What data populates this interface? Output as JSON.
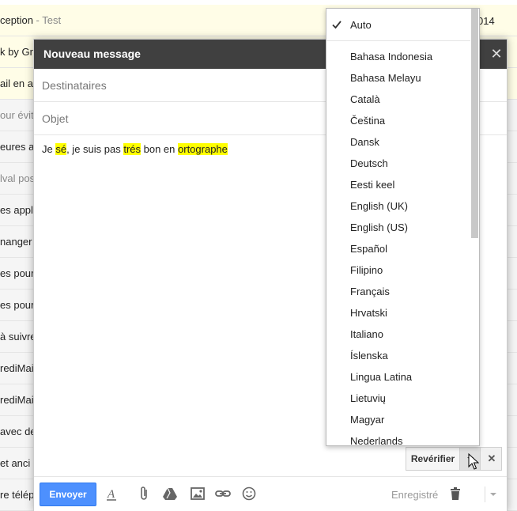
{
  "background": {
    "rows": [
      {
        "text": "ception",
        "muted": " - Test",
        "style": "unread"
      },
      {
        "text": "k by Gm",
        "muted": "",
        "style": "unread"
      },
      {
        "text": "ail en a",
        "muted": "",
        "style": "unread"
      },
      {
        "text": "",
        "muted": "our évite",
        "style": "read"
      },
      {
        "text": "eures a",
        "muted": "",
        "style": "read"
      },
      {
        "text": "",
        "muted": "lval pos",
        "style": "read"
      },
      {
        "text": "es applis",
        "muted": "",
        "style": "read"
      },
      {
        "text": "nanger t",
        "muted": "",
        "style": "read"
      },
      {
        "text": "es pour",
        "muted": "",
        "style": "read"
      },
      {
        "text": "es pour",
        "muted": "",
        "style": "read"
      },
      {
        "text": "à suivre",
        "muted": "",
        "style": "read"
      },
      {
        "text": "rediMai",
        "muted": "",
        "style": "read"
      },
      {
        "text": "rediMai",
        "muted": "",
        "style": "read"
      },
      {
        "text": "avec de",
        "muted": "",
        "style": "read"
      },
      {
        "text": " et anci",
        "muted": "",
        "style": "read"
      },
      {
        "text": "re télépl",
        "muted": "",
        "style": "read"
      }
    ],
    "date_fragment": "014"
  },
  "compose": {
    "title": "Nouveau message",
    "recipients_placeholder": "Destinataires",
    "subject_placeholder": "Objet",
    "body": {
      "p1": "Je ",
      "m1": "sé",
      "p2": ", je suis pas ",
      "m2": "trés",
      "p3": " bon en ",
      "m3": "ortographe"
    }
  },
  "spellcheck": {
    "recheck_label": "Revérifier",
    "menu": {
      "auto_label": "Auto",
      "languages": [
        "Bahasa Indonesia",
        "Bahasa Melayu",
        "Català",
        "Čeština",
        "Dansk",
        "Deutsch",
        "Eesti keel",
        "English (UK)",
        "English (US)",
        "Español",
        "Filipino",
        "Français",
        "Hrvatski",
        "Italiano",
        "Íslenska",
        "Lingua Latina",
        "Lietuvių",
        "Magyar",
        "Nederlands"
      ]
    }
  },
  "toolbar": {
    "send_label": "Envoyer",
    "saved_label": "Enregistré"
  },
  "colors": {
    "header_bg": "#404040",
    "send_button": "#4d90fe",
    "misspelling_highlight": "#ffff00",
    "unread_row": "#fffde7"
  },
  "icons": {
    "close": "close-icon",
    "check": "check-icon",
    "formatting": "text-format-icon",
    "attach": "paperclip-icon",
    "drive": "drive-icon",
    "photo": "photo-icon",
    "link": "link-icon",
    "emoji": "emoji-icon",
    "trash": "trash-icon"
  }
}
